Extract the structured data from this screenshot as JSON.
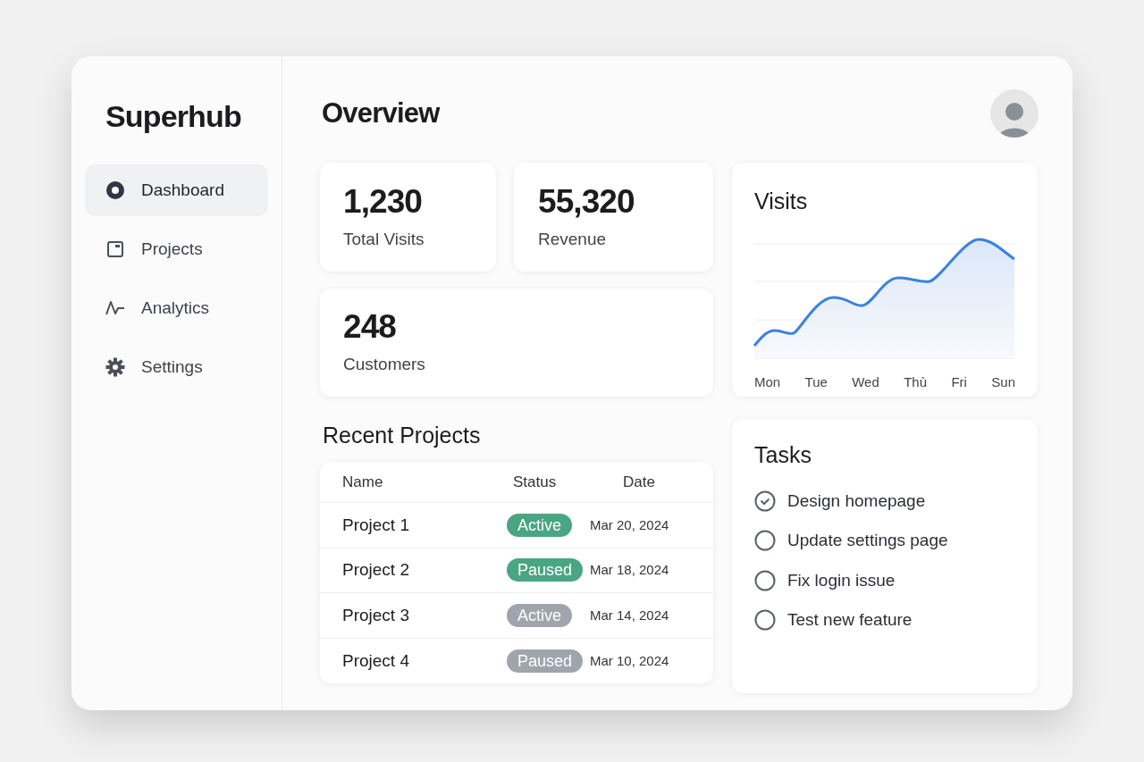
{
  "sidebar": {
    "brand": "Superhub",
    "items": [
      {
        "label": "Dashboard",
        "selected": true
      },
      {
        "label": "Projects",
        "selected": false
      },
      {
        "label": "Analytics",
        "selected": false
      },
      {
        "label": "Settings",
        "selected": false
      }
    ]
  },
  "header": {
    "title": "Overview"
  },
  "stats": [
    {
      "value": "1,230",
      "label": "Total Visits"
    },
    {
      "value": "55,320",
      "label": "Revenue"
    },
    {
      "value": "248",
      "label": "Customers"
    }
  ],
  "visits": {
    "title": "Visits",
    "day_labels": [
      "Mon",
      "Tue",
      "Wed",
      "Thù",
      "Fri",
      "Sun"
    ]
  },
  "recent_projects": {
    "title": "Recent Projects",
    "columns": [
      "Name",
      "Status",
      "Date"
    ],
    "rows": [
      {
        "name": "Project 1",
        "status": "Active",
        "color": "#4aa585",
        "date": "Mar 20, 2024"
      },
      {
        "name": "Project 2",
        "status": "Paused",
        "color": "#4aa585",
        "date": "Mar 18, 2024"
      },
      {
        "name": "Project 3",
        "status": "Active",
        "color": "#a0a5ad",
        "date": "Mar 14, 2024"
      },
      {
        "name": "Project 4",
        "status": "Paused",
        "color": "#a0a5ad",
        "date": "Mar 10, 2024"
      }
    ]
  },
  "tasks": {
    "title": "Tasks",
    "items": [
      {
        "label": "Design homepage",
        "checked": true
      },
      {
        "label": "Update settings page",
        "checked": false
      },
      {
        "label": "Fix login issue",
        "checked": false
      },
      {
        "label": "Test new feature",
        "checked": false
      }
    ]
  }
}
